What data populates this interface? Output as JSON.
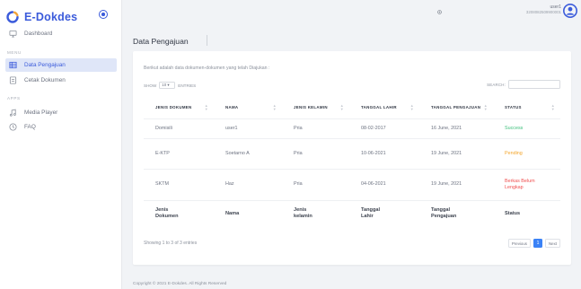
{
  "app": {
    "name": "E-Dokdes",
    "accent": "#3b5bdb"
  },
  "sidebar": {
    "menu_section": "MENU",
    "apps_section": "APPS",
    "items": [
      {
        "label": "Dashboard",
        "icon": "monitor-icon"
      },
      {
        "label": "Data Pengajuan",
        "icon": "table-icon",
        "active": true
      },
      {
        "label": "Cetak Dokumen",
        "icon": "document-icon"
      },
      {
        "label": "Media Player",
        "icon": "music-icon"
      },
      {
        "label": "FAQ",
        "icon": "help-icon"
      }
    ]
  },
  "topbar": {
    "user_name": "user1",
    "user_id": "3208082509900001",
    "settings_icon": "gear-icon",
    "avatar_icon": "user-circle-icon"
  },
  "page": {
    "title": "Data Pengajuan"
  },
  "card": {
    "intro": "Berikut adalah data dokumen-dokumen yang telah Diajukan :",
    "show_label": "SHOW",
    "show_value": "10 ▾",
    "entries_label": "ENTRIES",
    "search_label": "SEARCH:",
    "search_value": ""
  },
  "table": {
    "headers": [
      "JENIS DOKUMEN",
      "NAMA",
      "JENIS KELAMIN",
      "TANGGAL LAHIR",
      "TANGGAL PENGAJUAN",
      "STATUS"
    ],
    "rows": [
      [
        "Domisili",
        "user1",
        "Pria",
        "08-02-2017",
        "16 June, 2021",
        "Success"
      ],
      [
        "E-KTP",
        "Soetarno A",
        "Pria",
        "10-06-2021",
        "19 June, 2021",
        "Pending"
      ],
      [
        "SKTM",
        "Haz",
        "Pria",
        "04-06-2021",
        "19 June, 2021",
        "Berkas Belum Lengkap"
      ]
    ],
    "status_colors": {
      "Success": "#3ec07c",
      "Pending": "#f4a52a",
      "Berkas Belum Lengkap": "#f04f4f"
    },
    "footers": [
      "Jenis Dokumen",
      "Nama",
      "Jenis kelamin",
      "Tanggal Lahir",
      "Tanggal Pengajuan",
      "Status"
    ]
  },
  "pagination": {
    "info": "Showing 1 to 3 of 3 entries",
    "previous": "Previous",
    "current": "1",
    "next": "Next"
  },
  "footer": {
    "text": "Copyright © 2021 E-Dokdes. All Rights Reserved"
  }
}
